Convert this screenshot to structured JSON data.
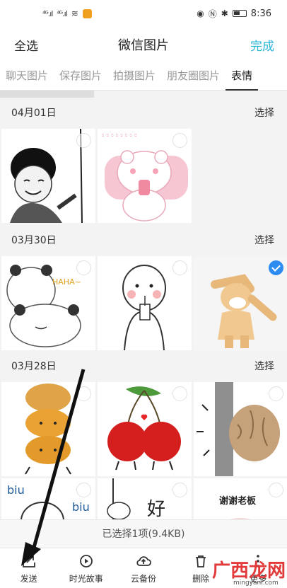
{
  "status_bar": {
    "time": "8:36",
    "signal1": "⁴ᴳ.ıl",
    "signal2": "⁴ᴳ.ıl"
  },
  "header": {
    "select_all": "全选",
    "title": "微信图片",
    "done": "完成"
  },
  "tabs": [
    {
      "label": "聊天图片",
      "active": false
    },
    {
      "label": "保存图片",
      "active": false
    },
    {
      "label": "拍摄图片",
      "active": false
    },
    {
      "label": "朋友圈图片",
      "active": false
    },
    {
      "label": "表情",
      "active": true
    }
  ],
  "sections": [
    {
      "date": "04月01日",
      "select_label": "选择"
    },
    {
      "date": "03月30日",
      "select_label": "选择"
    },
    {
      "date": "03月28日",
      "select_label": "选择"
    }
  ],
  "stickers": {
    "text_biu_1": "biu",
    "text_biu_2": "biu",
    "text_haha": "HAHA~",
    "text_thanks": "谢谢老板",
    "text_hao": "好"
  },
  "selection_bar": {
    "text": "已选择1项(9.4KB)"
  },
  "toolbar": [
    {
      "label": "发送",
      "icon": "send-icon"
    },
    {
      "label": "时光故事",
      "icon": "story-icon"
    },
    {
      "label": "云备份",
      "icon": "cloud-upload-icon"
    },
    {
      "label": "删除",
      "icon": "delete-icon"
    },
    {
      "label": "更多",
      "icon": "more-icon"
    }
  ],
  "watermark": {
    "text": "广西龙网",
    "url": "mingyanl.com"
  },
  "colors": {
    "accent": "#27b5d6",
    "check": "#2e8bf0",
    "watermark": "#e23a3a"
  }
}
